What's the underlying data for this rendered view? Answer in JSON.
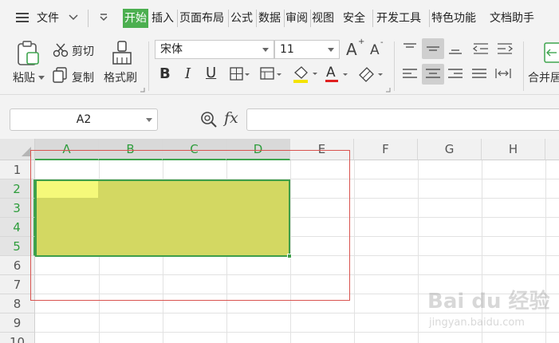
{
  "menu": {
    "file": "文件",
    "tabs": [
      "开始",
      "插入",
      "页面布局",
      "公式",
      "数据",
      "审阅",
      "视图",
      "安全",
      "开发工具",
      "特色功能",
      "文档助手"
    ]
  },
  "ribbon": {
    "paste": "粘贴",
    "cut": "剪切",
    "copy": "复制",
    "format_painter": "格式刷",
    "font_name": "宋体",
    "font_size": "11",
    "merge": "合并居"
  },
  "formula_bar": {
    "name_box": "A2",
    "fx": "fx",
    "value": ""
  },
  "sheet": {
    "columns": [
      "A",
      "B",
      "C",
      "D",
      "E",
      "F",
      "G",
      "H"
    ],
    "rows": [
      "1",
      "2",
      "3",
      "4",
      "5",
      "6",
      "7",
      "8",
      "9",
      "10"
    ],
    "selection": "A2:D5",
    "active_cell": "A2"
  },
  "watermark": {
    "text": "Bai du 经验",
    "url": "jingyan.baidu.com"
  },
  "colors": {
    "accent": "#4caf50",
    "selection_fill": "#d3d862",
    "active_cell": "#f5f97a",
    "annotation_box": "#d9534f"
  }
}
